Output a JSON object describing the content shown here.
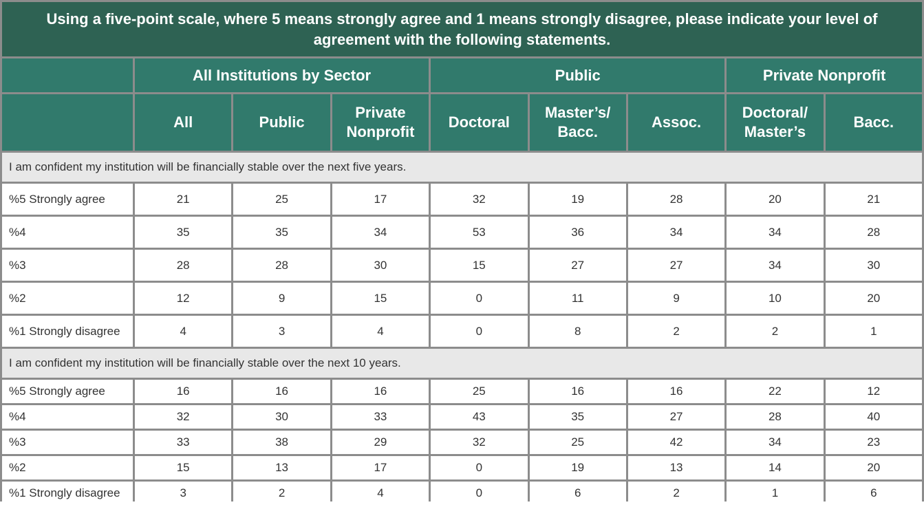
{
  "title": "Using a five-point scale, where 5 means strongly agree and 1 means strongly disagree, please indicate your level of agreement with the following statements.",
  "groups": [
    {
      "label": "All Institutions by Sector"
    },
    {
      "label": "Public"
    },
    {
      "label": "Private Nonprofit"
    }
  ],
  "columns": [
    "All",
    "Public",
    "Private Nonprofit",
    "Doctoral",
    "Master’s/ Bacc.",
    "Assoc.",
    "Doctoral/ Master’s",
    "Bacc."
  ],
  "colors": {
    "title_bg": "#2e6253",
    "header_bg": "#317a6c",
    "border": "#8c8c8c",
    "section_bg": "#e8e8e8"
  },
  "sections": [
    {
      "statement": "I am confident my institution will be financially stable over the next five years.",
      "rows": [
        {
          "label": "%5 Strongly agree",
          "values": [
            "21",
            "25",
            "17",
            "32",
            "19",
            "28",
            "20",
            "21"
          ]
        },
        {
          "label": "%4",
          "values": [
            "35",
            "35",
            "34",
            "53",
            "36",
            "34",
            "34",
            "28"
          ]
        },
        {
          "label": "%3",
          "values": [
            "28",
            "28",
            "30",
            "15",
            "27",
            "27",
            "34",
            "30"
          ]
        },
        {
          "label": "%2",
          "values": [
            "12",
            "9",
            "15",
            "0",
            "11",
            "9",
            "10",
            "20"
          ]
        },
        {
          "label": "%1 Strongly disagree",
          "values": [
            "4",
            "3",
            "4",
            "0",
            "8",
            "2",
            "2",
            "1"
          ]
        }
      ]
    },
    {
      "statement": "I am confident my institution will be financially stable over the next 10 years.",
      "rows": [
        {
          "label": "%5 Strongly agree",
          "values": [
            "16",
            "16",
            "16",
            "25",
            "16",
            "16",
            "22",
            "12"
          ]
        },
        {
          "label": "%4",
          "values": [
            "32",
            "30",
            "33",
            "43",
            "35",
            "27",
            "28",
            "40"
          ]
        },
        {
          "label": "%3",
          "values": [
            "33",
            "38",
            "29",
            "32",
            "25",
            "42",
            "34",
            "23"
          ]
        },
        {
          "label": "%2",
          "values": [
            "15",
            "13",
            "17",
            "0",
            "19",
            "13",
            "14",
            "20"
          ]
        },
        {
          "label": "%1 Strongly disagree",
          "values": [
            "3",
            "2",
            "4",
            "0",
            "6",
            "2",
            "1",
            "6"
          ]
        }
      ]
    }
  ]
}
